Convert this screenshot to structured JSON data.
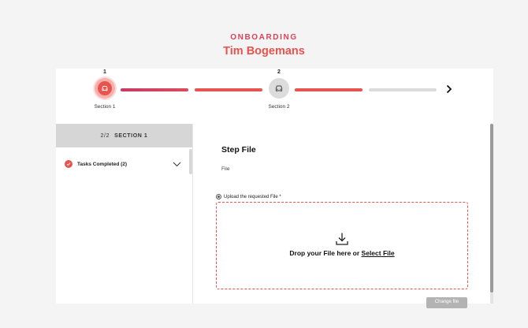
{
  "header": {
    "eyebrow": "ONBOARDING",
    "name": "Tim Bogemans"
  },
  "stepper": {
    "steps": [
      {
        "number": "1",
        "label": "Section 1",
        "icon": "car-icon",
        "state": "active"
      },
      {
        "number": "2",
        "label": "Section 2",
        "icon": "car-icon",
        "state": "inactive"
      }
    ],
    "next_icon": "chevron-right-icon",
    "colors": {
      "active": "#e8534e",
      "inactive": "#dcdcdc",
      "gradient_start": "#c93a64"
    }
  },
  "sidebar": {
    "section_count": "2/2",
    "section_title": "SECTION 1",
    "task_label": "Tasks Completed (2)",
    "task_icon": "check-circle-icon",
    "expand_icon": "chevron-down-icon"
  },
  "main": {
    "step_title": "Step File",
    "step_subtitle": "File",
    "upload_label": "Upload the requested File *",
    "drop_text": "Drop your File here or ",
    "select_link": "Select File",
    "change_button": "Change file"
  },
  "colors": {
    "accent": "#e8534e",
    "accent_pink": "#d9435a",
    "background": "#f4f4f4"
  }
}
